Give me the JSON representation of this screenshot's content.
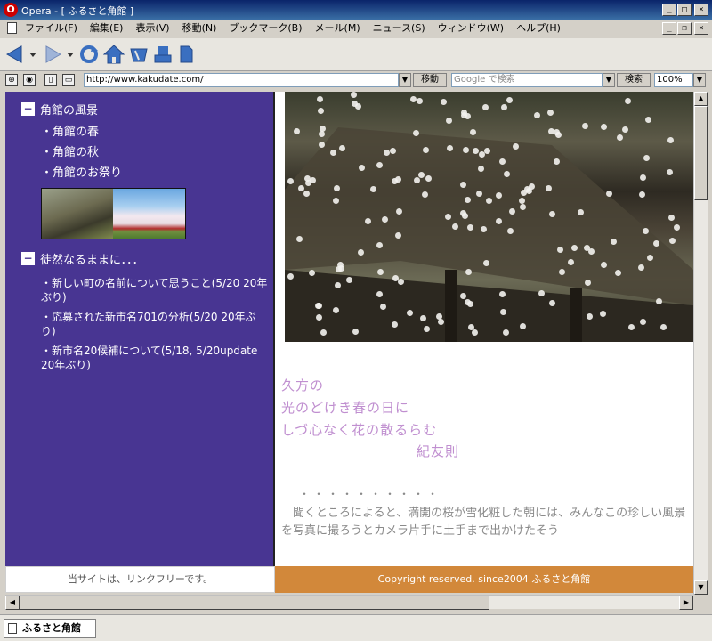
{
  "window": {
    "title": "Opera - [ ふるさと角館 ]",
    "app_icon": "O"
  },
  "menu": [
    "ファイル(F)",
    "編集(E)",
    "表示(V)",
    "移動(N)",
    "ブックマーク(B)",
    "メール(M)",
    "ニュース(S)",
    "ウィンドウ(W)",
    "ヘルプ(H)"
  ],
  "address": {
    "url": "http://www.kakudate.com/",
    "go_label": "移動",
    "search_placeholder": "Google で検索",
    "search_label": "検索",
    "zoom": "100%"
  },
  "sidebar": {
    "section1": "角館の風景",
    "links1": [
      "・角館の春",
      "・角館の秋",
      "・角館のお祭り"
    ],
    "section2": "徒然なるままに．．．",
    "links2": [
      "・新しい町の名前について思うこと(5/20 20年ぶり)",
      "・応募された新市名701の分析(5/20 20年ぶり)",
      "・新市名20候補について(5/18, 5/20update 20年ぶり)"
    ]
  },
  "main": {
    "poem": [
      "久方の",
      "光のどけき春の日に",
      "しづ心なく花の散るらむ"
    ],
    "author": "紀友則",
    "dots": "・・・・・・・・・・",
    "paragraph": "　聞くところによると、満開の桜が雪化粧した朝には、みんなこの珍しい風景を写真に撮ろうとカメラ片手に土手まで出かけたそう"
  },
  "footer": {
    "left": "当サイトは、リンクフリーです。",
    "right": "Copyright reserved. since2004 ふるさと角館"
  },
  "status": {
    "tab_label": "ふるさと角館"
  },
  "colors": {
    "sidebar_bg": "#483592",
    "footer_right_bg": "#d2883a",
    "poem_text": "#c08fd0"
  }
}
